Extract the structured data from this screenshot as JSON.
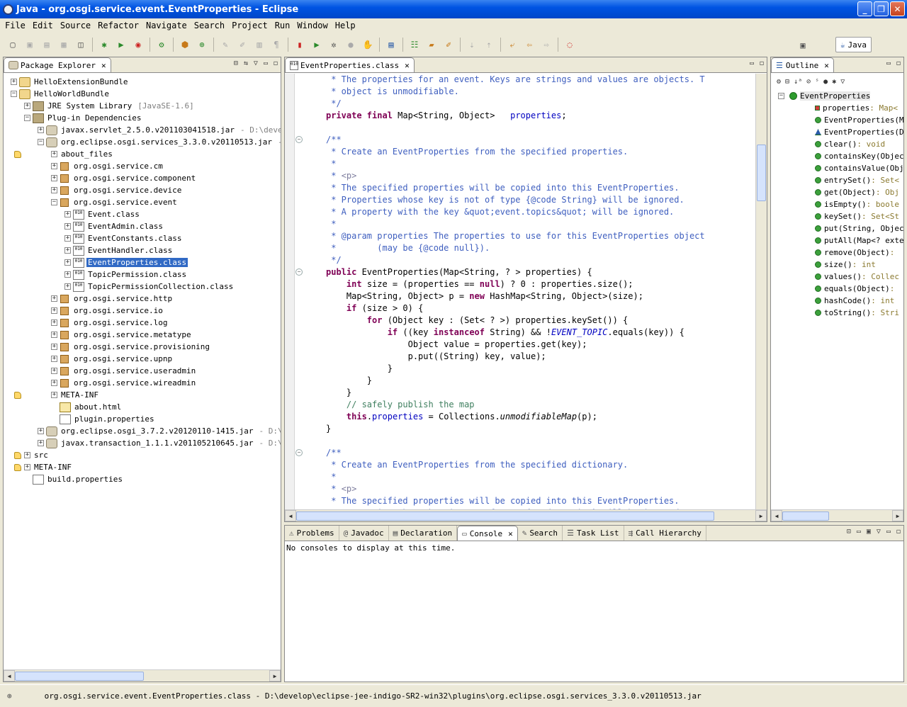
{
  "window": {
    "title": "Java - org.osgi.service.event.EventProperties - Eclipse",
    "min": "_",
    "max": "❐",
    "close": "✕"
  },
  "menu": [
    "File",
    "Edit",
    "Source",
    "Refactor",
    "Navigate",
    "Search",
    "Project",
    "Run",
    "Window",
    "Help"
  ],
  "perspective": {
    "label": "Java"
  },
  "package_explorer": {
    "title": "Package Explorer",
    "tree": [
      {
        "d": 0,
        "t": "+",
        "i": "proj",
        "l": "HelloExtensionBundle"
      },
      {
        "d": 0,
        "t": "-",
        "i": "proj",
        "l": "HelloWorldBundle"
      },
      {
        "d": 1,
        "t": "+",
        "i": "lib",
        "l": "JRE System Library",
        "x": "[JavaSE-1.6]"
      },
      {
        "d": 1,
        "t": "-",
        "i": "lib",
        "l": "Plug-in Dependencies"
      },
      {
        "d": 2,
        "t": "+",
        "i": "jar",
        "l": "javax.servlet_2.5.0.v201103041518.jar",
        "x": "- D:\\develop\\"
      },
      {
        "d": 2,
        "t": "-",
        "i": "jar",
        "l": "org.eclipse.osgi.services_3.3.0.v20110513.jar",
        "x": "- D:\\"
      },
      {
        "d": 3,
        "t": "+",
        "i": "fold",
        "l": "about_files"
      },
      {
        "d": 3,
        "t": "+",
        "i": "pkg",
        "l": "org.osgi.service.cm"
      },
      {
        "d": 3,
        "t": "+",
        "i": "pkg",
        "l": "org.osgi.service.component"
      },
      {
        "d": 3,
        "t": "+",
        "i": "pkg",
        "l": "org.osgi.service.device"
      },
      {
        "d": 3,
        "t": "-",
        "i": "pkg",
        "l": "org.osgi.service.event"
      },
      {
        "d": 4,
        "t": "+",
        "i": "cls",
        "l": "Event.class"
      },
      {
        "d": 4,
        "t": "+",
        "i": "cls",
        "l": "EventAdmin.class"
      },
      {
        "d": 4,
        "t": "+",
        "i": "cls",
        "l": "EventConstants.class"
      },
      {
        "d": 4,
        "t": "+",
        "i": "cls",
        "l": "EventHandler.class"
      },
      {
        "d": 4,
        "t": "+",
        "i": "cls",
        "l": "EventProperties.class",
        "sel": true
      },
      {
        "d": 4,
        "t": "+",
        "i": "cls",
        "l": "TopicPermission.class"
      },
      {
        "d": 4,
        "t": "+",
        "i": "cls",
        "l": "TopicPermissionCollection.class"
      },
      {
        "d": 3,
        "t": "+",
        "i": "pkg",
        "l": "org.osgi.service.http"
      },
      {
        "d": 3,
        "t": "+",
        "i": "pkg",
        "l": "org.osgi.service.io"
      },
      {
        "d": 3,
        "t": "+",
        "i": "pkg",
        "l": "org.osgi.service.log"
      },
      {
        "d": 3,
        "t": "+",
        "i": "pkg",
        "l": "org.osgi.service.metatype"
      },
      {
        "d": 3,
        "t": "+",
        "i": "pkg",
        "l": "org.osgi.service.provisioning"
      },
      {
        "d": 3,
        "t": "+",
        "i": "pkg",
        "l": "org.osgi.service.upnp"
      },
      {
        "d": 3,
        "t": "+",
        "i": "pkg",
        "l": "org.osgi.service.useradmin"
      },
      {
        "d": 3,
        "t": "+",
        "i": "pkg",
        "l": "org.osgi.service.wireadmin"
      },
      {
        "d": 3,
        "t": "+",
        "i": "fold",
        "l": "META-INF"
      },
      {
        "d": 3,
        "t": "",
        "i": "html",
        "l": "about.html"
      },
      {
        "d": 3,
        "t": "",
        "i": "file",
        "l": "plugin.properties"
      },
      {
        "d": 2,
        "t": "+",
        "i": "jar",
        "l": "org.eclipse.osgi_3.7.2.v20120110-1415.jar",
        "x": "- D:\\deve"
      },
      {
        "d": 2,
        "t": "+",
        "i": "jar",
        "l": "javax.transaction_1.1.1.v201105210645.jar",
        "x": "- D:\\deve"
      },
      {
        "d": 1,
        "t": "+",
        "i": "fold",
        "l": "src"
      },
      {
        "d": 1,
        "t": "+",
        "i": "fold",
        "l": "META-INF"
      },
      {
        "d": 1,
        "t": "",
        "i": "file",
        "l": "build.properties"
      }
    ]
  },
  "editor": {
    "tab": "EventProperties.class",
    "lines": [
      [
        [
          "jd",
          " * The properties for an event. Keys are strings and values are objects. T"
        ]
      ],
      [
        [
          "jd",
          " * object is unmodifiable."
        ]
      ],
      [
        [
          "jd",
          " */"
        ]
      ],
      [
        [
          "kw",
          "private final "
        ],
        [
          "",
          "Map<String, Object>   "
        ],
        [
          "fd",
          "properties"
        ],
        [
          "",
          ";"
        ]
      ],
      [
        [
          "",
          ""
        ]
      ],
      [
        [
          "jd",
          "/**"
        ]
      ],
      [
        [
          "jd",
          " * Create an EventProperties from the specified properties."
        ]
      ],
      [
        [
          "jd",
          " *"
        ]
      ],
      [
        [
          "jd",
          " * "
        ],
        [
          "tg",
          "<p>"
        ]
      ],
      [
        [
          "jd",
          " * The specified properties will be copied into this EventProperties."
        ]
      ],
      [
        [
          "jd",
          " * Properties whose key is not of type {@code String} will be ignored."
        ]
      ],
      [
        [
          "jd",
          " * A property with the key &quot;event.topics&quot; will be ignored."
        ]
      ],
      [
        [
          "jd",
          " *"
        ]
      ],
      [
        [
          "jd",
          " * @param properties The properties to use for this EventProperties object"
        ]
      ],
      [
        [
          "jd",
          " *        (may be {@code null})."
        ]
      ],
      [
        [
          "jd",
          " */"
        ]
      ],
      [
        [
          "kw",
          "public "
        ],
        [
          "",
          "EventProperties(Map<String, ? > properties) {"
        ]
      ],
      [
        [
          "",
          "    "
        ],
        [
          "kw",
          "int "
        ],
        [
          "",
          "size = (properties == "
        ],
        [
          "kw",
          "null"
        ],
        [
          "",
          ") ? 0 : properties.size();"
        ]
      ],
      [
        [
          "",
          "    Map<String, Object> p = "
        ],
        [
          "kw",
          "new "
        ],
        [
          "",
          "HashMap<String, Object>(size);"
        ]
      ],
      [
        [
          "",
          "    "
        ],
        [
          "kw",
          "if "
        ],
        [
          "",
          "(size > 0) {"
        ]
      ],
      [
        [
          "",
          "        "
        ],
        [
          "kw",
          "for "
        ],
        [
          "",
          "(Object key : (Set< ? >) properties.keySet()) {"
        ]
      ],
      [
        [
          "",
          "            "
        ],
        [
          "kw",
          "if "
        ],
        [
          "",
          "((key "
        ],
        [
          "kw",
          "instanceof "
        ],
        [
          "",
          "String) && !"
        ],
        [
          "ct",
          "EVENT_TOPIC"
        ],
        [
          "",
          ".equals(key)) {"
        ]
      ],
      [
        [
          "",
          "                Object value = properties.get(key);"
        ]
      ],
      [
        [
          "",
          "                p.put((String) key, value);"
        ]
      ],
      [
        [
          "",
          "            }"
        ]
      ],
      [
        [
          "",
          "        }"
        ]
      ],
      [
        [
          "",
          "    }"
        ]
      ],
      [
        [
          "",
          "    "
        ],
        [
          "cm",
          "// safely publish the map"
        ]
      ],
      [
        [
          "",
          "    "
        ],
        [
          "kw",
          "this"
        ],
        [
          "",
          "."
        ],
        [
          "fd",
          "properties"
        ],
        [
          "",
          " = Collections."
        ],
        [
          "it",
          "unmodifiableMap"
        ],
        [
          "",
          "(p);"
        ]
      ],
      [
        [
          "",
          "}"
        ]
      ],
      [
        [
          "",
          ""
        ]
      ],
      [
        [
          "jd",
          "/**"
        ]
      ],
      [
        [
          "jd",
          " * Create an EventProperties from the specified dictionary."
        ]
      ],
      [
        [
          "jd",
          " *"
        ]
      ],
      [
        [
          "jd",
          " * "
        ],
        [
          "tg",
          "<p>"
        ]
      ],
      [
        [
          "jd",
          " * The specified properties will be copied into this EventProperties."
        ]
      ],
      [
        [
          "jd",
          " * Properties whose key is not of type {@code String} will be ignored."
        ]
      ]
    ]
  },
  "outline": {
    "title": "Outline",
    "items": [
      {
        "k": "cls",
        "n": "EventProperties",
        "t": ""
      },
      {
        "k": "pri",
        "n": "properties",
        "t": " : Map<"
      },
      {
        "k": "pub",
        "n": "EventProperties(M",
        "t": ""
      },
      {
        "k": "tri",
        "n": "EventProperties(D",
        "t": ""
      },
      {
        "k": "pub",
        "n": "clear()",
        "t": " : void"
      },
      {
        "k": "pub",
        "n": "containsKey(Objec",
        "t": ""
      },
      {
        "k": "pub",
        "n": "containsValue(Obj",
        "t": ""
      },
      {
        "k": "pub",
        "n": "entrySet()",
        "t": " : Set<"
      },
      {
        "k": "pub",
        "n": "get(Object)",
        "t": " : Obj"
      },
      {
        "k": "pub",
        "n": "isEmpty()",
        "t": " : boole"
      },
      {
        "k": "pub",
        "n": "keySet()",
        "t": " : Set<St"
      },
      {
        "k": "pub",
        "n": "put(String, Objec",
        "t": ""
      },
      {
        "k": "pub",
        "n": "putAll(Map<? exte",
        "t": ""
      },
      {
        "k": "pub",
        "n": "remove(Object)",
        "t": " : "
      },
      {
        "k": "pub",
        "n": "size()",
        "t": " : int"
      },
      {
        "k": "pub",
        "n": "values()",
        "t": " : Collec"
      },
      {
        "k": "pub",
        "n": "equals(Object)",
        "t": " : "
      },
      {
        "k": "pub",
        "n": "hashCode()",
        "t": " : int"
      },
      {
        "k": "pub",
        "n": "toString()",
        "t": " : Stri"
      }
    ]
  },
  "console": {
    "tabs": [
      "Problems",
      "Javadoc",
      "Declaration",
      "Console",
      "Search",
      "Task List",
      "Call Hierarchy"
    ],
    "active": "Console",
    "message": "No consoles to display at this time."
  },
  "status": {
    "text": "org.osgi.service.event.EventProperties.class - D:\\develop\\eclipse-jee-indigo-SR2-win32\\plugins\\org.eclipse.osgi.services_3.3.0.v20110513.jar"
  }
}
